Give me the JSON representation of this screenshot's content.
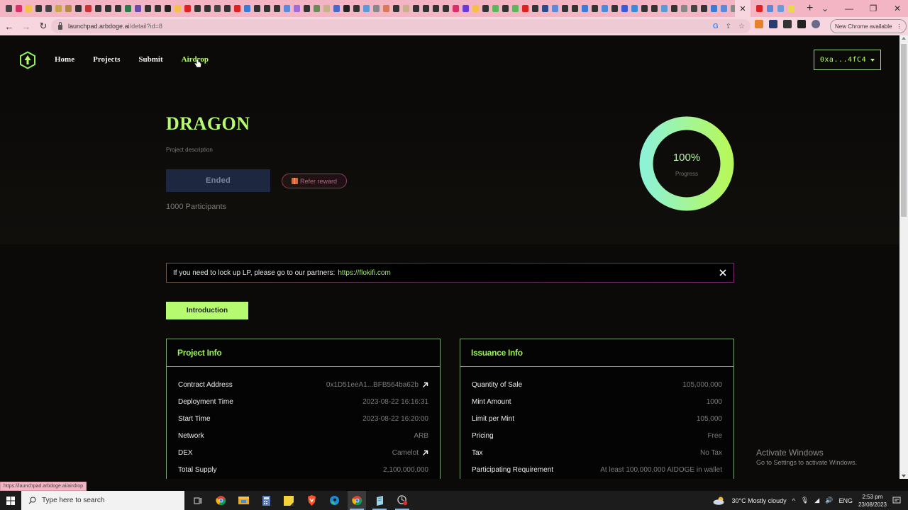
{
  "browser": {
    "active_tab_close": "✕",
    "new_tab": "+",
    "url_host": "launchpad.arbdoge.ai",
    "url_path": "/detail?id=8",
    "new_chrome_label": "New Chrome available",
    "window_controls": [
      "⌄",
      "—",
      "❐",
      "✕"
    ],
    "status_url": "https://launchpad.arbdoge.ai/airdrop",
    "tab_favicon_colors": [
      "#444",
      "#d9306b",
      "#f4c04a",
      "#333",
      "#444",
      "#c9a64a",
      "#b5894a",
      "#333",
      "#c33",
      "#333",
      "#333",
      "#333",
      "#2a7a4a",
      "#6a4aa8",
      "#333",
      "#333",
      "#222",
      "#f4c04a",
      "#d22",
      "#333",
      "#333",
      "#444",
      "#333",
      "#d22",
      "#3a7bd5",
      "#333",
      "#333",
      "#333",
      "#5a8ad8",
      "#a46ad8",
      "#333",
      "#6a8a5a",
      "#c8b08a",
      "#4a6ac8",
      "#222",
      "#333",
      "#5a9ad8",
      "#888",
      "#d87a5a",
      "#333",
      "#c8b08a",
      "#333",
      "#333",
      "#333",
      "#333",
      "#d9306b",
      "#6a3ad8",
      "#f4c04a",
      "#333",
      "#5ab85a",
      "#333",
      "#5ab85a",
      "#d22",
      "#333",
      "#2a4a8a",
      "#5a8ad8",
      "#333",
      "#333",
      "#3a7bd5",
      "#333",
      "#4a8ad8",
      "#333",
      "#3a5ad8",
      "#3a8ad8",
      "#333",
      "#333",
      "#5a9ad8",
      "#333",
      "#888",
      "#444",
      "#333",
      "#3a7bd5",
      "#5a8ad8",
      "#888",
      "#333",
      "#333",
      "#e08a3a",
      "#888",
      "#333",
      "#f4c04a",
      "#d8a8d8",
      "#333",
      "#333",
      "#888",
      "#d89ab8",
      "#333",
      "#333",
      "#333",
      "#d22",
      "#333",
      "#d8a8b8",
      "#d22",
      "#f4c04a",
      "#333",
      "#333",
      "#333",
      "#888",
      "#d87a8a"
    ],
    "tabs_after_active_colors": [
      "#d22",
      "#5a8ad8",
      "#6a9ad8",
      "#e8d84a"
    ],
    "extension_colors": [
      "#e8822a",
      "#2a3a6a",
      "#333",
      "#222",
      "#6a6a8a"
    ]
  },
  "site": {
    "nav": [
      {
        "label": "Home",
        "active": false
      },
      {
        "label": "Projects",
        "active": false
      },
      {
        "label": "Submit",
        "active": false
      },
      {
        "label": "Airdrop",
        "active": true
      }
    ],
    "wallet": "0xa...4fC4",
    "accent_color": "#b6fb6f"
  },
  "project": {
    "name": "DRAGON",
    "description": "Project description",
    "status_button": "Ended",
    "refer_button": "Refer reward",
    "participants": "1000 Participants",
    "progress": {
      "value_percent": 100,
      "label": "100%",
      "caption": "Progress"
    }
  },
  "alert": {
    "text": "If you need to lock up LP, please go to our partners:",
    "link": "https://flokifi.com"
  },
  "tabs": [
    {
      "label": "Introduction",
      "active": true
    }
  ],
  "project_info": {
    "title": "Project Info",
    "rows": [
      {
        "key": "Contract Address",
        "value": "0x1D51eeA1...BFB564ba62b",
        "link": true
      },
      {
        "key": "Deployment Time",
        "value": "2023-08-22 16:16:31",
        "link": false
      },
      {
        "key": "Start Time",
        "value": "2023-08-22 16:20:00",
        "link": false
      },
      {
        "key": "Network",
        "value": "ARB",
        "link": false
      },
      {
        "key": "DEX",
        "value": "Camelot",
        "link": true
      },
      {
        "key": "Total Supply",
        "value": "2,100,000,000",
        "link": false
      }
    ]
  },
  "issuance_info": {
    "title": "Issuance Info",
    "rows": [
      {
        "key": "Quantity of Sale",
        "value": "105,000,000"
      },
      {
        "key": "Mint Amount",
        "value": "1000"
      },
      {
        "key": "Limit per Mint",
        "value": "105,000"
      },
      {
        "key": "Pricing",
        "value": "Free"
      },
      {
        "key": "Tax",
        "value": "No Tax"
      },
      {
        "key": "Participating Requirement",
        "value": "At least 100,000,000 AIDOGE in wallet"
      }
    ]
  },
  "watermark": {
    "title": "Activate Windows",
    "subtitle": "Go to Settings to activate Windows."
  },
  "taskbar": {
    "search_placeholder": "Type here to search",
    "apps": [
      "task-view",
      "chrome",
      "file-explorer",
      "calculator",
      "sticky-notes",
      "brave",
      "edge",
      "chrome-profile",
      "notepad",
      "screen-recorder"
    ],
    "weather": "30°C  Mostly cloudy",
    "language": "ENG",
    "time": "2:53 pm",
    "date": "23/08/2023"
  }
}
